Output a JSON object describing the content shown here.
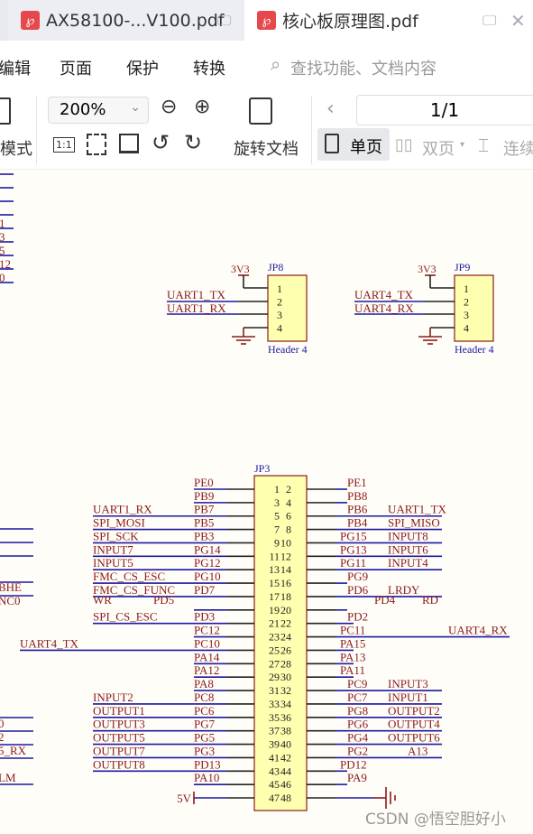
{
  "tabs": [
    {
      "label": "AX58100-...V100.pdf",
      "active": false
    },
    {
      "label": "核心板原理图.pdf",
      "active": true
    }
  ],
  "menu": {
    "items": [
      "编辑",
      "页面",
      "保护",
      "转换"
    ],
    "search_placeholder": "查找功能、文档内容"
  },
  "toolbar": {
    "mode_label": "模式",
    "zoom_value": "200%",
    "rotate_label": "旋转文档",
    "page_value": "1/1",
    "single_label": "单页",
    "double_label": "双页",
    "continuous_label": "连续"
  },
  "watermark": "CSDN @悟空胆好小",
  "schematic": {
    "colors": {
      "wire": "#1a1aa0",
      "pin": "#222",
      "text": "#8b1a1a",
      "box": "#ffffb0",
      "boxborder": "#8b1a1a",
      "designator": "#1a1aa0"
    },
    "top_left_fragments": [
      "1",
      "3",
      "5",
      "12",
      "0"
    ],
    "jp8": {
      "designator": "JP8",
      "power": "3V3",
      "nets": [
        "UART1_TX",
        "UART1_RX"
      ],
      "pins": [
        "1",
        "2",
        "3",
        "4"
      ],
      "footer": "Header 4"
    },
    "jp9": {
      "designator": "JP9",
      "power": "3V3",
      "nets": [
        "UART4_TX",
        "UART4_RX"
      ],
      "pins": [
        "1",
        "2",
        "3",
        "4"
      ],
      "footer": "Header 4"
    },
    "jp3": {
      "designator": "JP3",
      "left": [
        [
          "1",
          "PE0",
          ""
        ],
        [
          "3",
          "PB9",
          ""
        ],
        [
          "5",
          "PB7",
          "UART1_RX"
        ],
        [
          "7",
          "PB5",
          "SPI_MOSI"
        ],
        [
          "9",
          "PB3",
          "SPI_SCK"
        ],
        [
          "11",
          "PG14",
          "INPUT7"
        ],
        [
          "13",
          "PG12",
          "INPUT5"
        ],
        [
          "15",
          "PG10",
          "FMC_CS_ESC"
        ],
        [
          "17",
          "PD7",
          "FMC_CS_FUNC"
        ],
        [
          "19",
          "PD5",
          "WR"
        ],
        [
          "21",
          "PD3",
          "SPI_CS_ESC"
        ],
        [
          "23",
          "PC12",
          ""
        ],
        [
          "25",
          "PC10",
          "UART4_TX"
        ],
        [
          "27",
          "PA14",
          ""
        ],
        [
          "29",
          "PA12",
          ""
        ],
        [
          "31",
          "PA8",
          ""
        ],
        [
          "33",
          "PC8",
          "INPUT2"
        ],
        [
          "35",
          "PC6",
          "OUTPUT1"
        ],
        [
          "37",
          "PG7",
          "OUTPUT3"
        ],
        [
          "39",
          "PG5",
          "OUTPUT5"
        ],
        [
          "41",
          "PG3",
          "OUTPUT7"
        ],
        [
          "43",
          "PD13",
          "OUTPUT8"
        ],
        [
          "45",
          "PA10",
          ""
        ],
        [
          "47",
          "5V",
          ""
        ]
      ],
      "right": [
        [
          "2",
          "PE1",
          ""
        ],
        [
          "4",
          "PB8",
          ""
        ],
        [
          "6",
          "PB6",
          "UART1_TX"
        ],
        [
          "8",
          "PB4",
          "SPI_MISO"
        ],
        [
          "10",
          "PG15",
          "INPUT8"
        ],
        [
          "12",
          "PG13",
          "INPUT6"
        ],
        [
          "14",
          "PG11",
          "INPUT4"
        ],
        [
          "16",
          "PG9",
          ""
        ],
        [
          "18",
          "PD6",
          "LRDY"
        ],
        [
          "20",
          "PD4",
          "RD"
        ],
        [
          "22",
          "PD2",
          ""
        ],
        [
          "24",
          "PC11",
          "UART4_RX"
        ],
        [
          "26",
          "PA15",
          ""
        ],
        [
          "28",
          "PA13",
          ""
        ],
        [
          "30",
          "PA11",
          ""
        ],
        [
          "32",
          "PC9",
          "INPUT3"
        ],
        [
          "34",
          "PC7",
          "INPUT1"
        ],
        [
          "36",
          "PG8",
          "OUTPUT2"
        ],
        [
          "38",
          "PG6",
          "OUTPUT4"
        ],
        [
          "40",
          "PG4",
          "OUTPUT6"
        ],
        [
          "42",
          "PG2",
          "A13"
        ],
        [
          "44",
          "PD12",
          ""
        ],
        [
          "46",
          "PA9",
          ""
        ],
        [
          "48",
          "GND",
          ""
        ]
      ]
    },
    "left_edge_fragments": [
      "BHE",
      "NC0",
      "0",
      "2",
      "5_RX",
      "LM"
    ]
  }
}
